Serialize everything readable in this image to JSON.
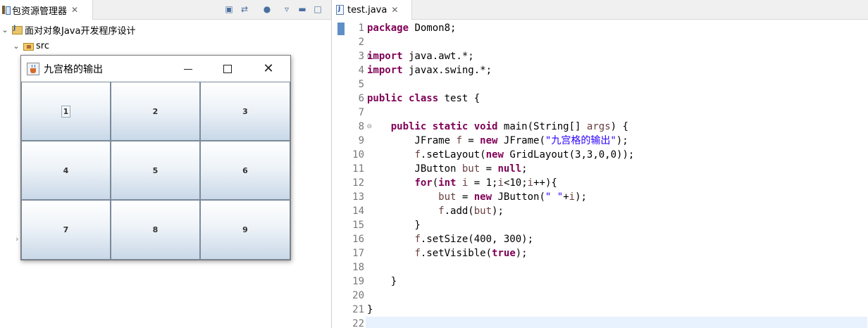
{
  "explorer": {
    "tab_label": "包资源管理器",
    "close_glyph": "✕",
    "project": "面对对象Java开发程序设计",
    "src_folder": "src",
    "expand_glyph": "⌄",
    "collapsed_glyph": "›"
  },
  "swing_window": {
    "title": "九宫格的输出",
    "buttons": [
      "1",
      "2",
      "3",
      "4",
      "5",
      "6",
      "7",
      "8",
      "9"
    ]
  },
  "editor": {
    "tab_label": "test.java",
    "close_glyph": "✕",
    "current_line": 22,
    "lines": [
      {
        "n": "1",
        "html": "<span class=\"kw\">package</span> Domon8;"
      },
      {
        "n": "2",
        "html": ""
      },
      {
        "n": "3",
        "html": "<span class=\"kw\">import</span> java.awt.*;",
        "fold": true
      },
      {
        "n": "4",
        "html": "<span class=\"kw\">import</span> javax.swing.*;"
      },
      {
        "n": "5",
        "html": ""
      },
      {
        "n": "6",
        "html": "<span class=\"kw\">public</span> <span class=\"kw\">class</span> test {"
      },
      {
        "n": "7",
        "html": ""
      },
      {
        "n": "8",
        "html": "    <span class=\"kw\">public</span> <span class=\"kw\">static</span> <span class=\"kw\">void</span> main(String[] <span class=\"var\">args</span>) {",
        "fold": true
      },
      {
        "n": "9",
        "html": "        JFrame <span class=\"var\">f</span> = <span class=\"kw\">new</span> JFrame(<span class=\"str\">\"九宫格的输出\"</span>);"
      },
      {
        "n": "10",
        "html": "        <span class=\"var\">f</span>.setLayout(<span class=\"kw\">new</span> GridLayout(3,3,0,0));"
      },
      {
        "n": "11",
        "html": "        JButton <span class=\"var\">but</span> = <span class=\"kw\">null</span>;"
      },
      {
        "n": "12",
        "html": "        <span class=\"kw\">for</span>(<span class=\"kw\">int</span> <span class=\"var\">i</span> = 1;<span class=\"var\">i</span>&lt;10;<span class=\"var\">i</span>++){"
      },
      {
        "n": "13",
        "html": "            <span class=\"var\">but</span> = <span class=\"kw\">new</span> JButton(<span class=\"str\">\" \"</span>+<span class=\"var\">i</span>);"
      },
      {
        "n": "14",
        "html": "            <span class=\"var\">f</span>.add(<span class=\"var\">but</span>);"
      },
      {
        "n": "15",
        "html": "        }"
      },
      {
        "n": "16",
        "html": "        <span class=\"var\">f</span>.setSize(400, 300);"
      },
      {
        "n": "17",
        "html": "        <span class=\"var\">f</span>.setVisible(<span class=\"kw\">true</span>);"
      },
      {
        "n": "18",
        "html": ""
      },
      {
        "n": "19",
        "html": "    }"
      },
      {
        "n": "20",
        "html": ""
      },
      {
        "n": "21",
        "html": "}"
      },
      {
        "n": "22",
        "html": ""
      }
    ]
  }
}
